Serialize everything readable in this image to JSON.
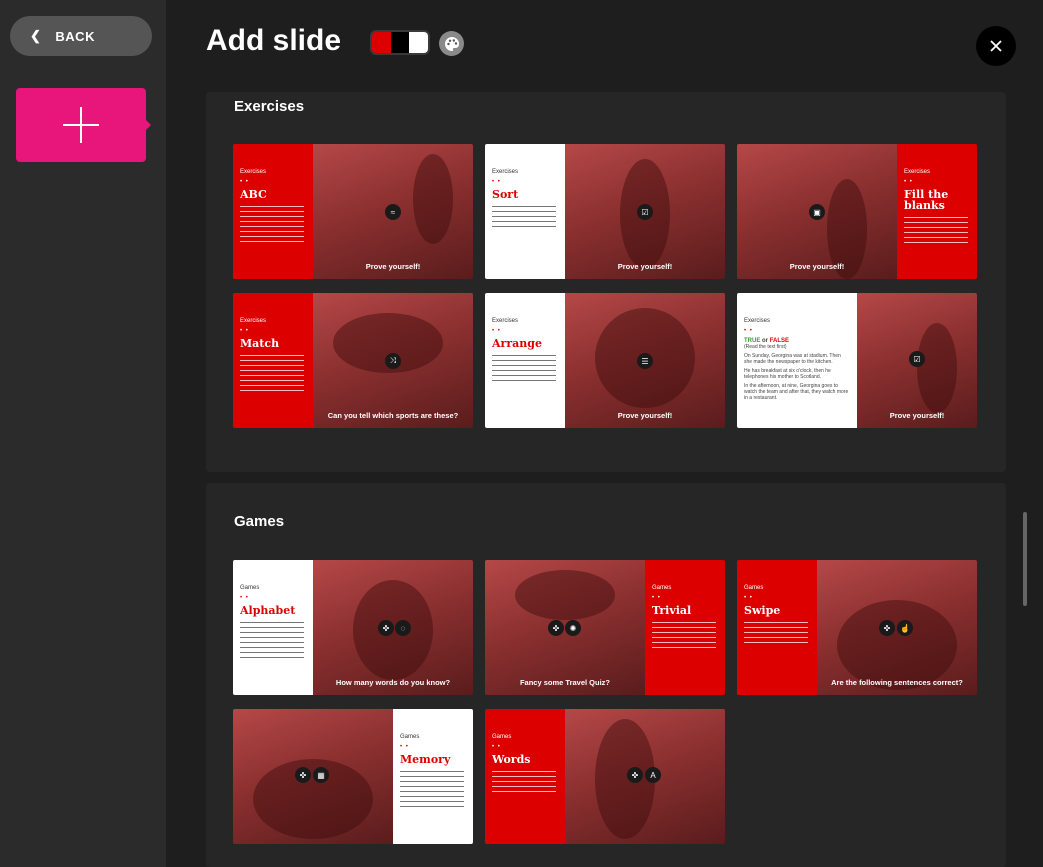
{
  "sidebar": {
    "back_label": "BACK"
  },
  "header": {
    "title": "Add slide",
    "swatch_colors": [
      "#dd0000",
      "#000000",
      "#ffffff"
    ]
  },
  "sections": {
    "exercises": {
      "title": "Exercises",
      "cards": {
        "abc": {
          "kicker": "Exercises",
          "name": "ABC",
          "caption": "Prove yourself!",
          "icon": "chart-icon"
        },
        "sort": {
          "kicker": "Exercises",
          "name": "Sort",
          "caption": "Prove yourself!",
          "icon": "check-icon"
        },
        "fill": {
          "kicker": "Exercises",
          "name": "Fill the blanks",
          "caption": "Prove yourself!",
          "icon": "blank-icon"
        },
        "match": {
          "kicker": "Exercises",
          "name": "Match",
          "caption": "Can you tell which sports are these?",
          "icon": "shuffle-icon"
        },
        "arrange": {
          "kicker": "Exercises",
          "name": "Arrange",
          "caption": "Prove yourself!",
          "icon": "list-icon"
        },
        "truefalse": {
          "kicker": "Exercises",
          "name_true": "TRUE",
          "name_or": "or",
          "name_false": "FALSE",
          "sub": "(Read the text first)",
          "line1": "On Sunday, Georgina was at stadium. Then she made the newspaper to the kitchen.",
          "line2": "He has breakfast at six o'clock, then he telephones his mother to Scotland.",
          "line3": "In the afternoon, at nine, Georgina goes to watch the team and after that, they watch more in a restaurant.",
          "caption": "Prove yourself!",
          "icon": "check-icon"
        }
      }
    },
    "games": {
      "title": "Games",
      "cards": {
        "alphabet": {
          "kicker": "Games",
          "name": "Alphabet",
          "caption": "How many words do you know?"
        },
        "trivial": {
          "kicker": "Games",
          "name": "Trivial",
          "caption": "Fancy some Travel Quiz?"
        },
        "swipe": {
          "kicker": "Games",
          "name": "Swipe",
          "caption": "Are the following sentences correct?"
        },
        "memory": {
          "kicker": "Games",
          "name": "Memory",
          "caption": ""
        },
        "words": {
          "kicker": "Games",
          "name": "Words",
          "caption": ""
        }
      }
    }
  }
}
